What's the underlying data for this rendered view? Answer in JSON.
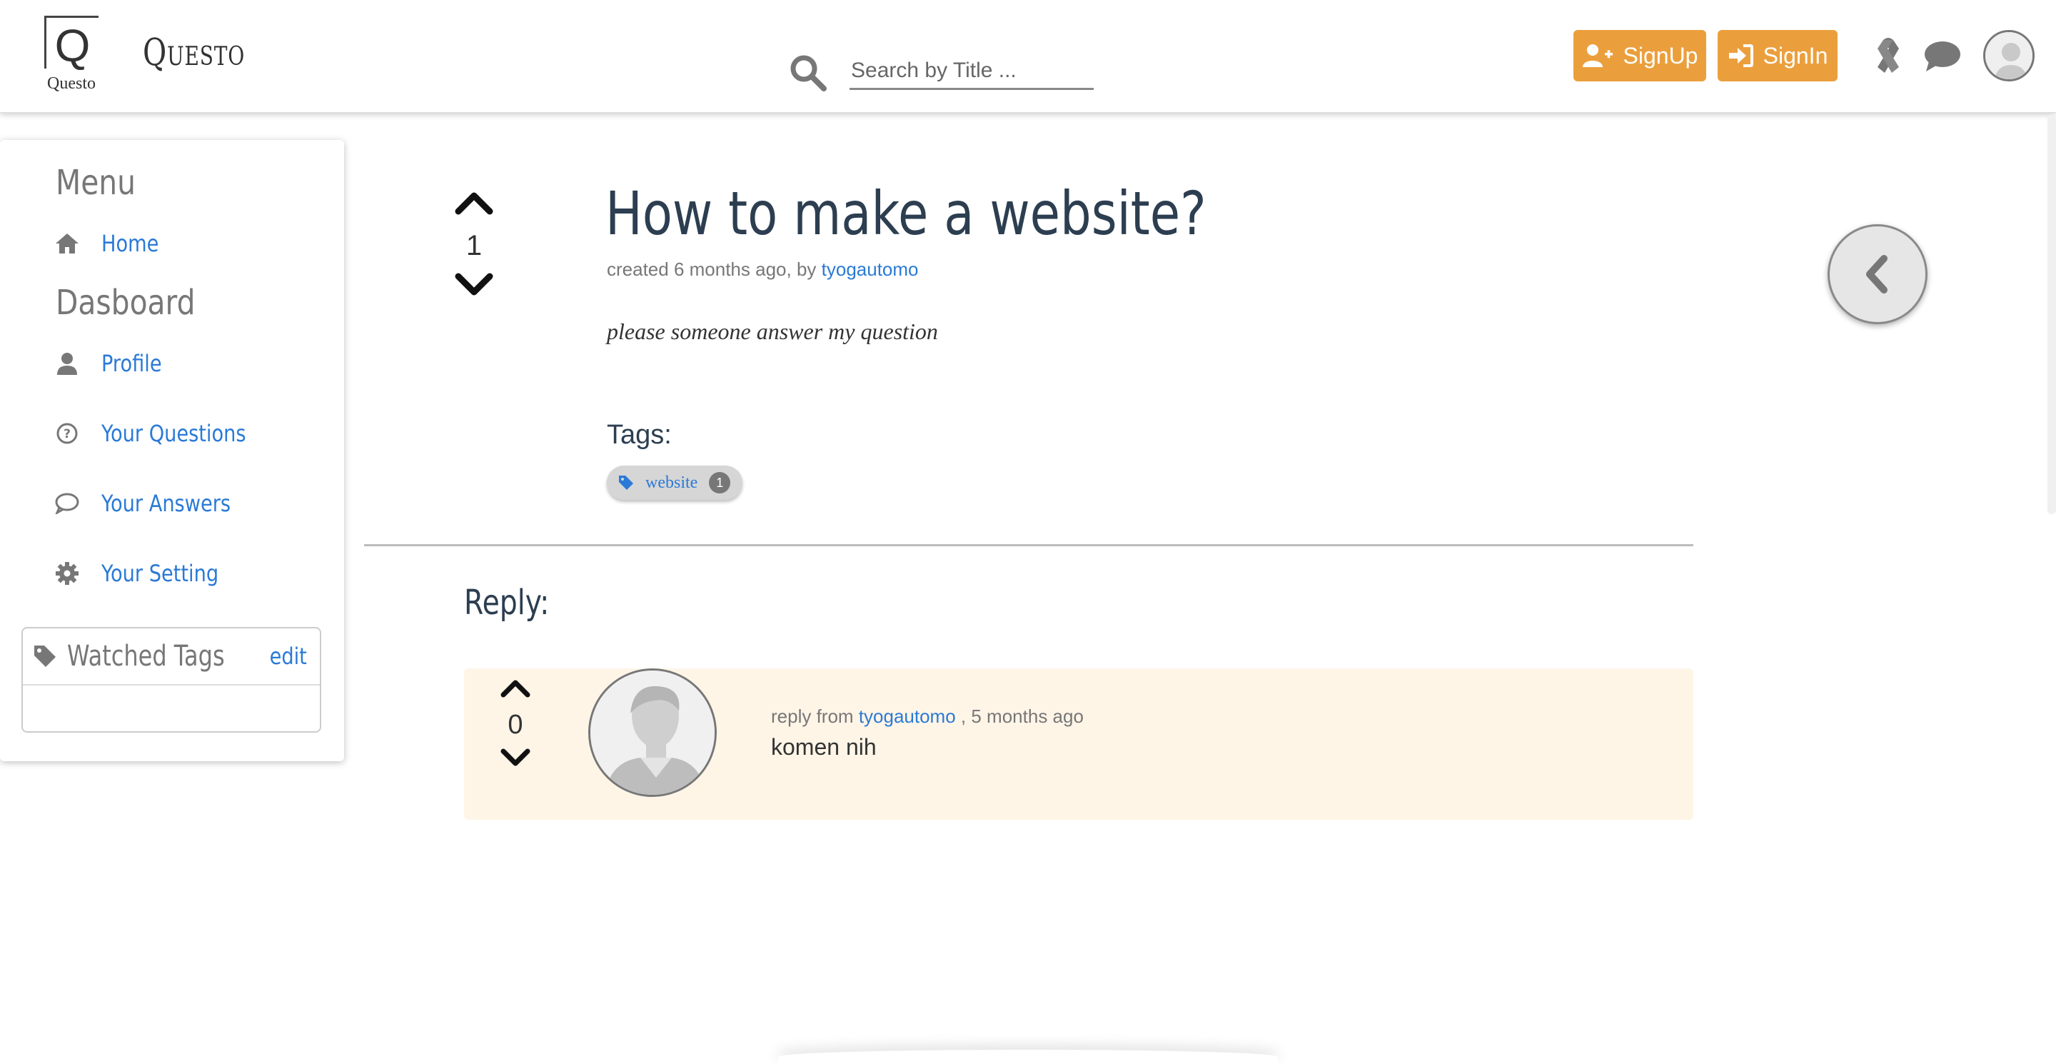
{
  "header": {
    "logo_letter": "Q",
    "logo_caption": "Questo",
    "brand": "Questo",
    "search_placeholder": "Search by Title ...",
    "signup_label": "SignUp",
    "signin_label": "SignIn"
  },
  "sidebar": {
    "menu_heading": "Menu",
    "dashboard_heading": "Dasboard",
    "items": [
      {
        "label": "Home",
        "icon": "home-icon"
      },
      {
        "label": "Profile",
        "icon": "user-icon"
      },
      {
        "label": "Your Questions",
        "icon": "question-circle-icon"
      },
      {
        "label": "Your Answers",
        "icon": "comment-icon"
      },
      {
        "label": "Your Setting",
        "icon": "gear-icon"
      }
    ],
    "watched_tags_title": "Watched Tags",
    "watched_tags_edit": "edit"
  },
  "question": {
    "votes": "1",
    "title": "How to make a website?",
    "meta_prefix": "created 6 months ago, by",
    "author": "tyogautomo",
    "body": "please someone answer my question",
    "tags_label": "Tags:",
    "tags": [
      {
        "name": "website",
        "count": "1"
      }
    ]
  },
  "reply": {
    "heading": "Reply:",
    "votes": "0",
    "meta_prefix": "reply from",
    "author": "tyogautomo",
    "meta_suffix": ", 5 months ago",
    "body": "komen nih"
  },
  "colors": {
    "accent_orange": "#eb9f3c",
    "link_blue": "#2a7ad6",
    "reply_bg": "#fef5e7",
    "title_dark": "#2c3e50"
  }
}
